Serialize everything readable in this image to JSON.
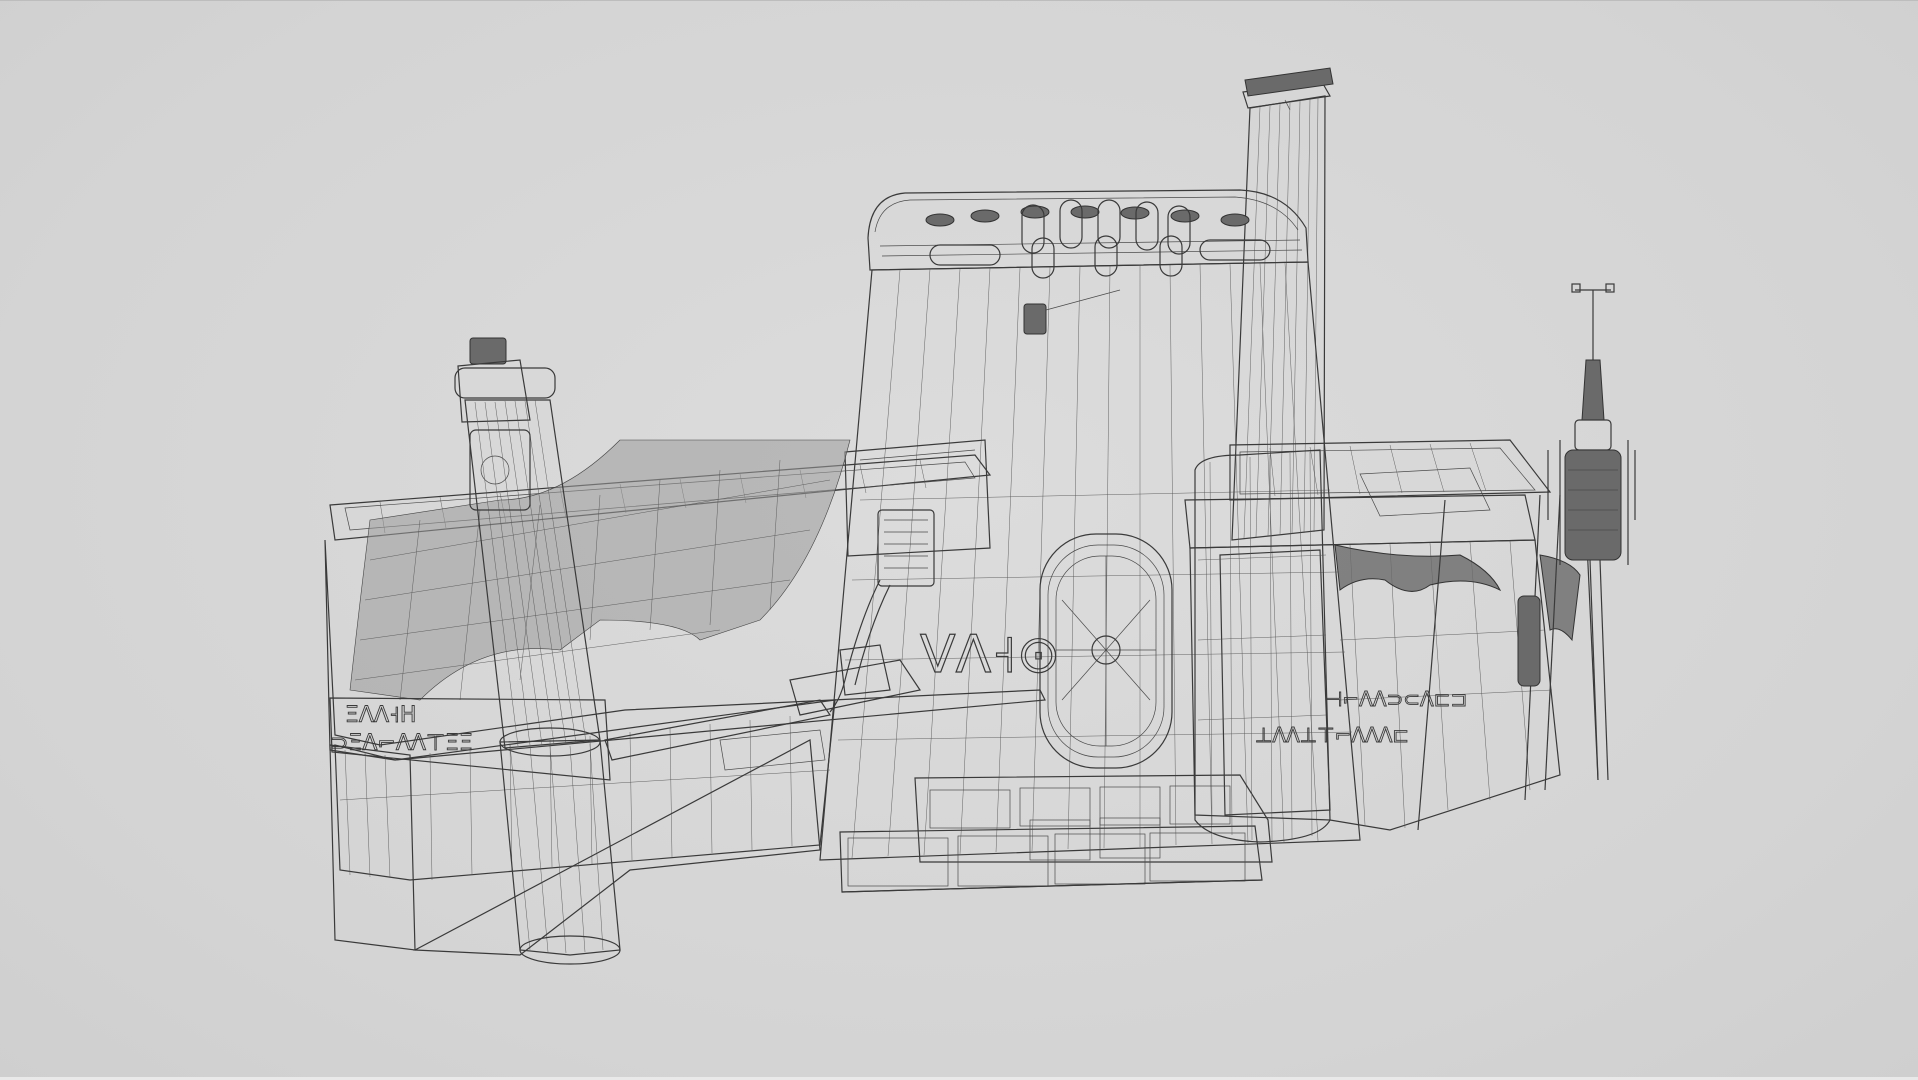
{
  "scene": {
    "background": "#d7d7d7",
    "wire_color": "#3a3a3a",
    "render_mode": "wireframe",
    "model": {
      "main_tower_glyphs": "VΛ˧⊙",
      "left_panel_glyphs_top": "ΞΛΛ˧Η",
      "left_panel_glyphs_bottom": "⊃ΞΛ⌐ΛΛ⊤ΞΞ",
      "right_panel_glyphs_top": "⊣⌐ΛΛ⊃⊂Λ⊏⊐",
      "right_panel_glyphs_bottom": "⊥ΛΛ⊥⊤⌐ΛΛΛ⊏"
    }
  }
}
